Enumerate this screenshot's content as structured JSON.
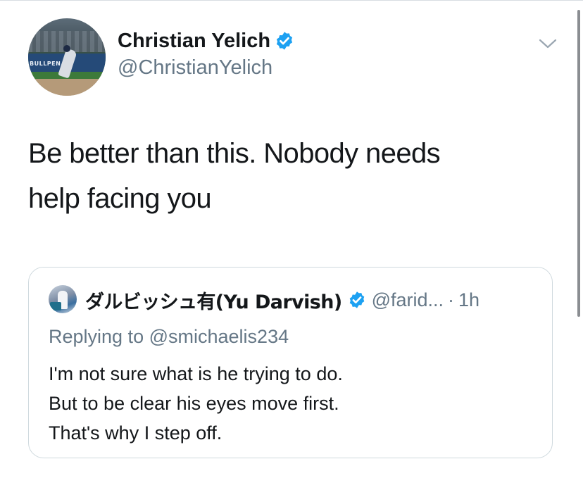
{
  "tweet": {
    "author_name": "Christian Yelich",
    "author_handle": "@ChristianYelich",
    "text_lines": [
      "Be better than this. Nobody needs",
      "help facing you"
    ],
    "avatar_wall_text": "BULLPEN",
    "icons": {
      "verified": "verified-badge-icon",
      "menu": "chevron-down-icon"
    }
  },
  "quoted_tweet": {
    "author_name": "ダルビッシュ有(Yu Darvish)",
    "author_handle": "@farid...",
    "separator": "·",
    "time": "1h",
    "replying_label": "Replying to",
    "replying_to": "@smichaelis234",
    "text_lines": [
      "I'm not sure what is he trying to do.",
      "But to be clear his eyes move first.",
      "That's why I step off."
    ]
  },
  "colors": {
    "text": "#14171a",
    "secondary_text": "#657786",
    "verified_blue": "#1da1f2",
    "border": "#cfd9de"
  }
}
